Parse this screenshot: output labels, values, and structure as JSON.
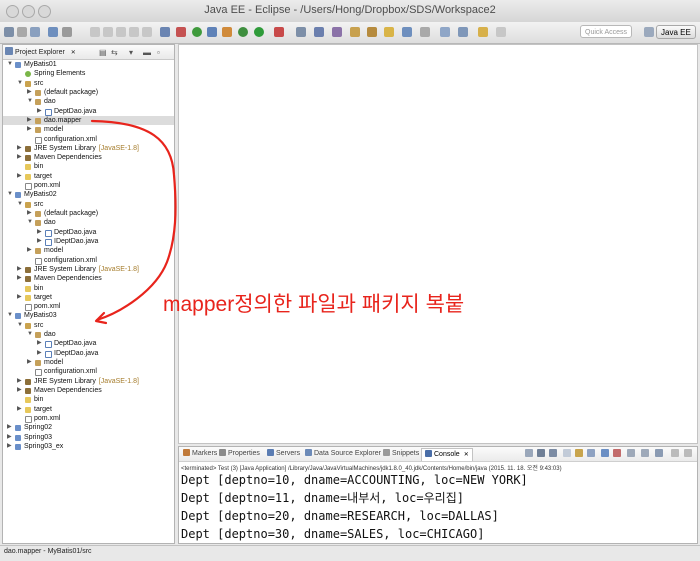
{
  "window": {
    "title": "Java EE - Eclipse - /Users/Hong/Dropbox/SDS/Workspace2"
  },
  "toolbar": {
    "quick_access_placeholder": "Quick Access",
    "perspective": "Java EE"
  },
  "explorer": {
    "tab": "Project Explorer",
    "tab_close": "✕",
    "tree": [
      {
        "indent": 0,
        "twisty": "▼",
        "icon": "project",
        "label": "MyBatis01"
      },
      {
        "indent": 1,
        "twisty": "",
        "icon": "spring",
        "label": "Spring Elements"
      },
      {
        "indent": 1,
        "twisty": "▼",
        "icon": "srcfolder",
        "label": "src"
      },
      {
        "indent": 2,
        "twisty": "▶",
        "icon": "package",
        "label": "(default package)"
      },
      {
        "indent": 2,
        "twisty": "▼",
        "icon": "package",
        "label": "dao"
      },
      {
        "indent": 3,
        "twisty": "▶",
        "icon": "java",
        "label": "DeptDao.java"
      },
      {
        "indent": 2,
        "twisty": "▶",
        "icon": "package",
        "label": "dao.mapper",
        "selected": true
      },
      {
        "indent": 2,
        "twisty": "▶",
        "icon": "package",
        "label": "model"
      },
      {
        "indent": 2,
        "twisty": "",
        "icon": "xml",
        "label": "configuration.xml"
      },
      {
        "indent": 1,
        "twisty": "▶",
        "icon": "library",
        "label": "JRE System Library",
        "deco": "[JavaSE-1.8]"
      },
      {
        "indent": 1,
        "twisty": "▶",
        "icon": "library",
        "label": "Maven Dependencies"
      },
      {
        "indent": 1,
        "twisty": "",
        "icon": "folder",
        "label": "bin"
      },
      {
        "indent": 1,
        "twisty": "▶",
        "icon": "folder",
        "label": "target"
      },
      {
        "indent": 1,
        "twisty": "",
        "icon": "xml",
        "label": "pom.xml"
      },
      {
        "indent": 0,
        "twisty": "▼",
        "icon": "project",
        "label": "MyBatis02"
      },
      {
        "indent": 1,
        "twisty": "▼",
        "icon": "srcfolder",
        "label": "src"
      },
      {
        "indent": 2,
        "twisty": "▶",
        "icon": "package",
        "label": "(default package)"
      },
      {
        "indent": 2,
        "twisty": "▼",
        "icon": "package",
        "label": "dao"
      },
      {
        "indent": 3,
        "twisty": "▶",
        "icon": "java",
        "label": "DeptDao.java"
      },
      {
        "indent": 3,
        "twisty": "▶",
        "icon": "java",
        "label": "IDeptDao.java"
      },
      {
        "indent": 2,
        "twisty": "▶",
        "icon": "package",
        "label": "model"
      },
      {
        "indent": 2,
        "twisty": "",
        "icon": "xml",
        "label": "configuration.xml"
      },
      {
        "indent": 1,
        "twisty": "▶",
        "icon": "library",
        "label": "JRE System Library",
        "deco": "[JavaSE-1.8]"
      },
      {
        "indent": 1,
        "twisty": "▶",
        "icon": "library",
        "label": "Maven Dependencies"
      },
      {
        "indent": 1,
        "twisty": "",
        "icon": "folder",
        "label": "bin"
      },
      {
        "indent": 1,
        "twisty": "▶",
        "icon": "folder",
        "label": "target"
      },
      {
        "indent": 1,
        "twisty": "",
        "icon": "xml",
        "label": "pom.xml"
      },
      {
        "indent": 0,
        "twisty": "▼",
        "icon": "project",
        "label": "MyBatis03"
      },
      {
        "indent": 1,
        "twisty": "▼",
        "icon": "srcfolder",
        "label": "src"
      },
      {
        "indent": 2,
        "twisty": "▼",
        "icon": "package",
        "label": "dao"
      },
      {
        "indent": 3,
        "twisty": "▶",
        "icon": "java",
        "label": "DeptDao.java"
      },
      {
        "indent": 3,
        "twisty": "▶",
        "icon": "java",
        "label": "IDeptDao.java"
      },
      {
        "indent": 2,
        "twisty": "▶",
        "icon": "package",
        "label": "model"
      },
      {
        "indent": 2,
        "twisty": "",
        "icon": "xml",
        "label": "configuration.xml"
      },
      {
        "indent": 1,
        "twisty": "▶",
        "icon": "library",
        "label": "JRE System Library",
        "deco": "[JavaSE-1.8]"
      },
      {
        "indent": 1,
        "twisty": "▶",
        "icon": "library",
        "label": "Maven Dependencies"
      },
      {
        "indent": 1,
        "twisty": "",
        "icon": "folder",
        "label": "bin"
      },
      {
        "indent": 1,
        "twisty": "▶",
        "icon": "folder",
        "label": "target"
      },
      {
        "indent": 1,
        "twisty": "",
        "icon": "xml",
        "label": "pom.xml"
      },
      {
        "indent": 0,
        "twisty": "▶",
        "icon": "project",
        "label": "Spring02"
      },
      {
        "indent": 0,
        "twisty": "▶",
        "icon": "project",
        "label": "Spring03"
      },
      {
        "indent": 0,
        "twisty": "▶",
        "icon": "project",
        "label": "Spring03_ex"
      }
    ]
  },
  "bottom_panel": {
    "tabs": [
      "Markers",
      "Properties",
      "Servers",
      "Data Source Explorer",
      "Snippets",
      "Console"
    ],
    "active_tab": "Console",
    "tab_close": "✕",
    "console_status": "<terminated> Test (3) [Java Application] /Library/Java/JavaVirtualMachines/jdk1.8.0_40.jdk/Contents/Home/bin/java (2015. 11. 18. 오전 9:43:03)",
    "console_lines": [
      "Dept [deptno=10, dname=ACCOUNTING, loc=NEW YORK]",
      "Dept [deptno=11, dname=내부서, loc=우리집]",
      "Dept [deptno=20, dname=RESEARCH, loc=DALLAS]",
      "Dept [deptno=30, dname=SALES, loc=CHICAGO]"
    ]
  },
  "status_bar": {
    "text": "dao.mapper - MyBatis01/src"
  },
  "annotation": {
    "text": "mapper정의한 파일과 패키지 복붙",
    "color": "#e8241c"
  }
}
